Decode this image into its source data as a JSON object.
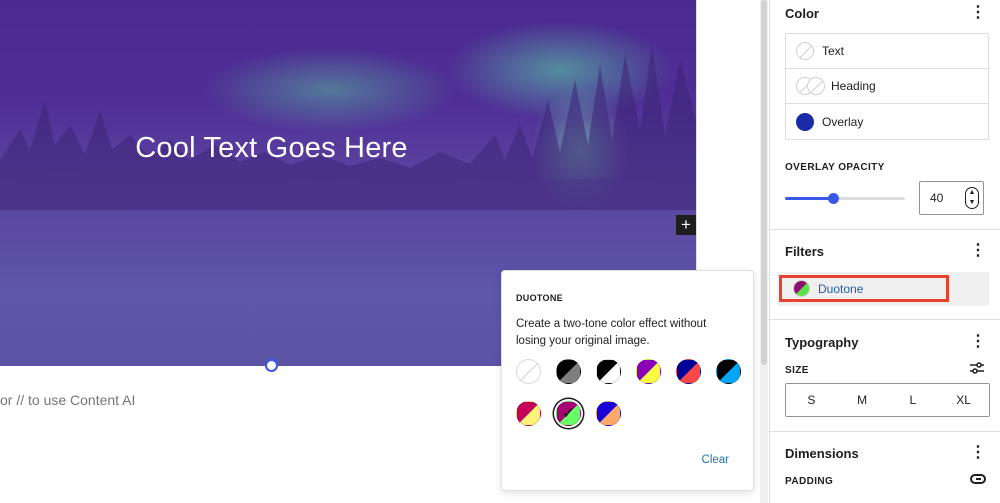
{
  "cover": {
    "title": "Cool Text Goes Here",
    "add_block_label": "+"
  },
  "editor": {
    "placeholder": "or // to use Content AI"
  },
  "sidebar": {
    "color_panel": {
      "title": "Color",
      "items": [
        {
          "label": "Text",
          "swatch": "empty"
        },
        {
          "label": "Heading",
          "swatch": "empty-pair"
        },
        {
          "label": "Overlay",
          "swatch": "#1b2aa8"
        }
      ]
    },
    "overlay_opacity": {
      "label": "OVERLAY OPACITY",
      "value": "40",
      "fraction": 0.4
    },
    "filters_panel": {
      "title": "Filters",
      "duotone_label": "Duotone"
    },
    "typography_panel": {
      "title": "Typography",
      "size_label": "SIZE",
      "sizes": [
        "S",
        "M",
        "L",
        "XL"
      ]
    },
    "dimensions_panel": {
      "title": "Dimensions",
      "padding_label": "PADDING"
    },
    "more_icon": "⋮"
  },
  "duotone_popover": {
    "title": "DUOTONE",
    "description": "Create a two-tone color effect without losing your original image.",
    "clear_label": "Clear",
    "swatches": [
      {
        "name": "unset",
        "colors": [
          "#ffffff",
          "#ffffff"
        ]
      },
      {
        "name": "dark-grayscale",
        "colors": [
          "#000000",
          "#7f7f7f"
        ]
      },
      {
        "name": "grayscale",
        "colors": [
          "#000000",
          "#ffffff"
        ]
      },
      {
        "name": "purple-yellow",
        "colors": [
          "#8c00b7",
          "#fcff41"
        ]
      },
      {
        "name": "blue-red",
        "colors": [
          "#000097",
          "#ff4747"
        ]
      },
      {
        "name": "midnight",
        "colors": [
          "#000000",
          "#00a5ff"
        ]
      },
      {
        "name": "magenta-yellow",
        "colors": [
          "#c7005a",
          "#fff278"
        ]
      },
      {
        "name": "purple-green",
        "colors": [
          "#a60072",
          "#67ff66"
        ],
        "selected": true
      },
      {
        "name": "blue-orange",
        "colors": [
          "#1900d8",
          "#ffa96b"
        ]
      }
    ]
  }
}
